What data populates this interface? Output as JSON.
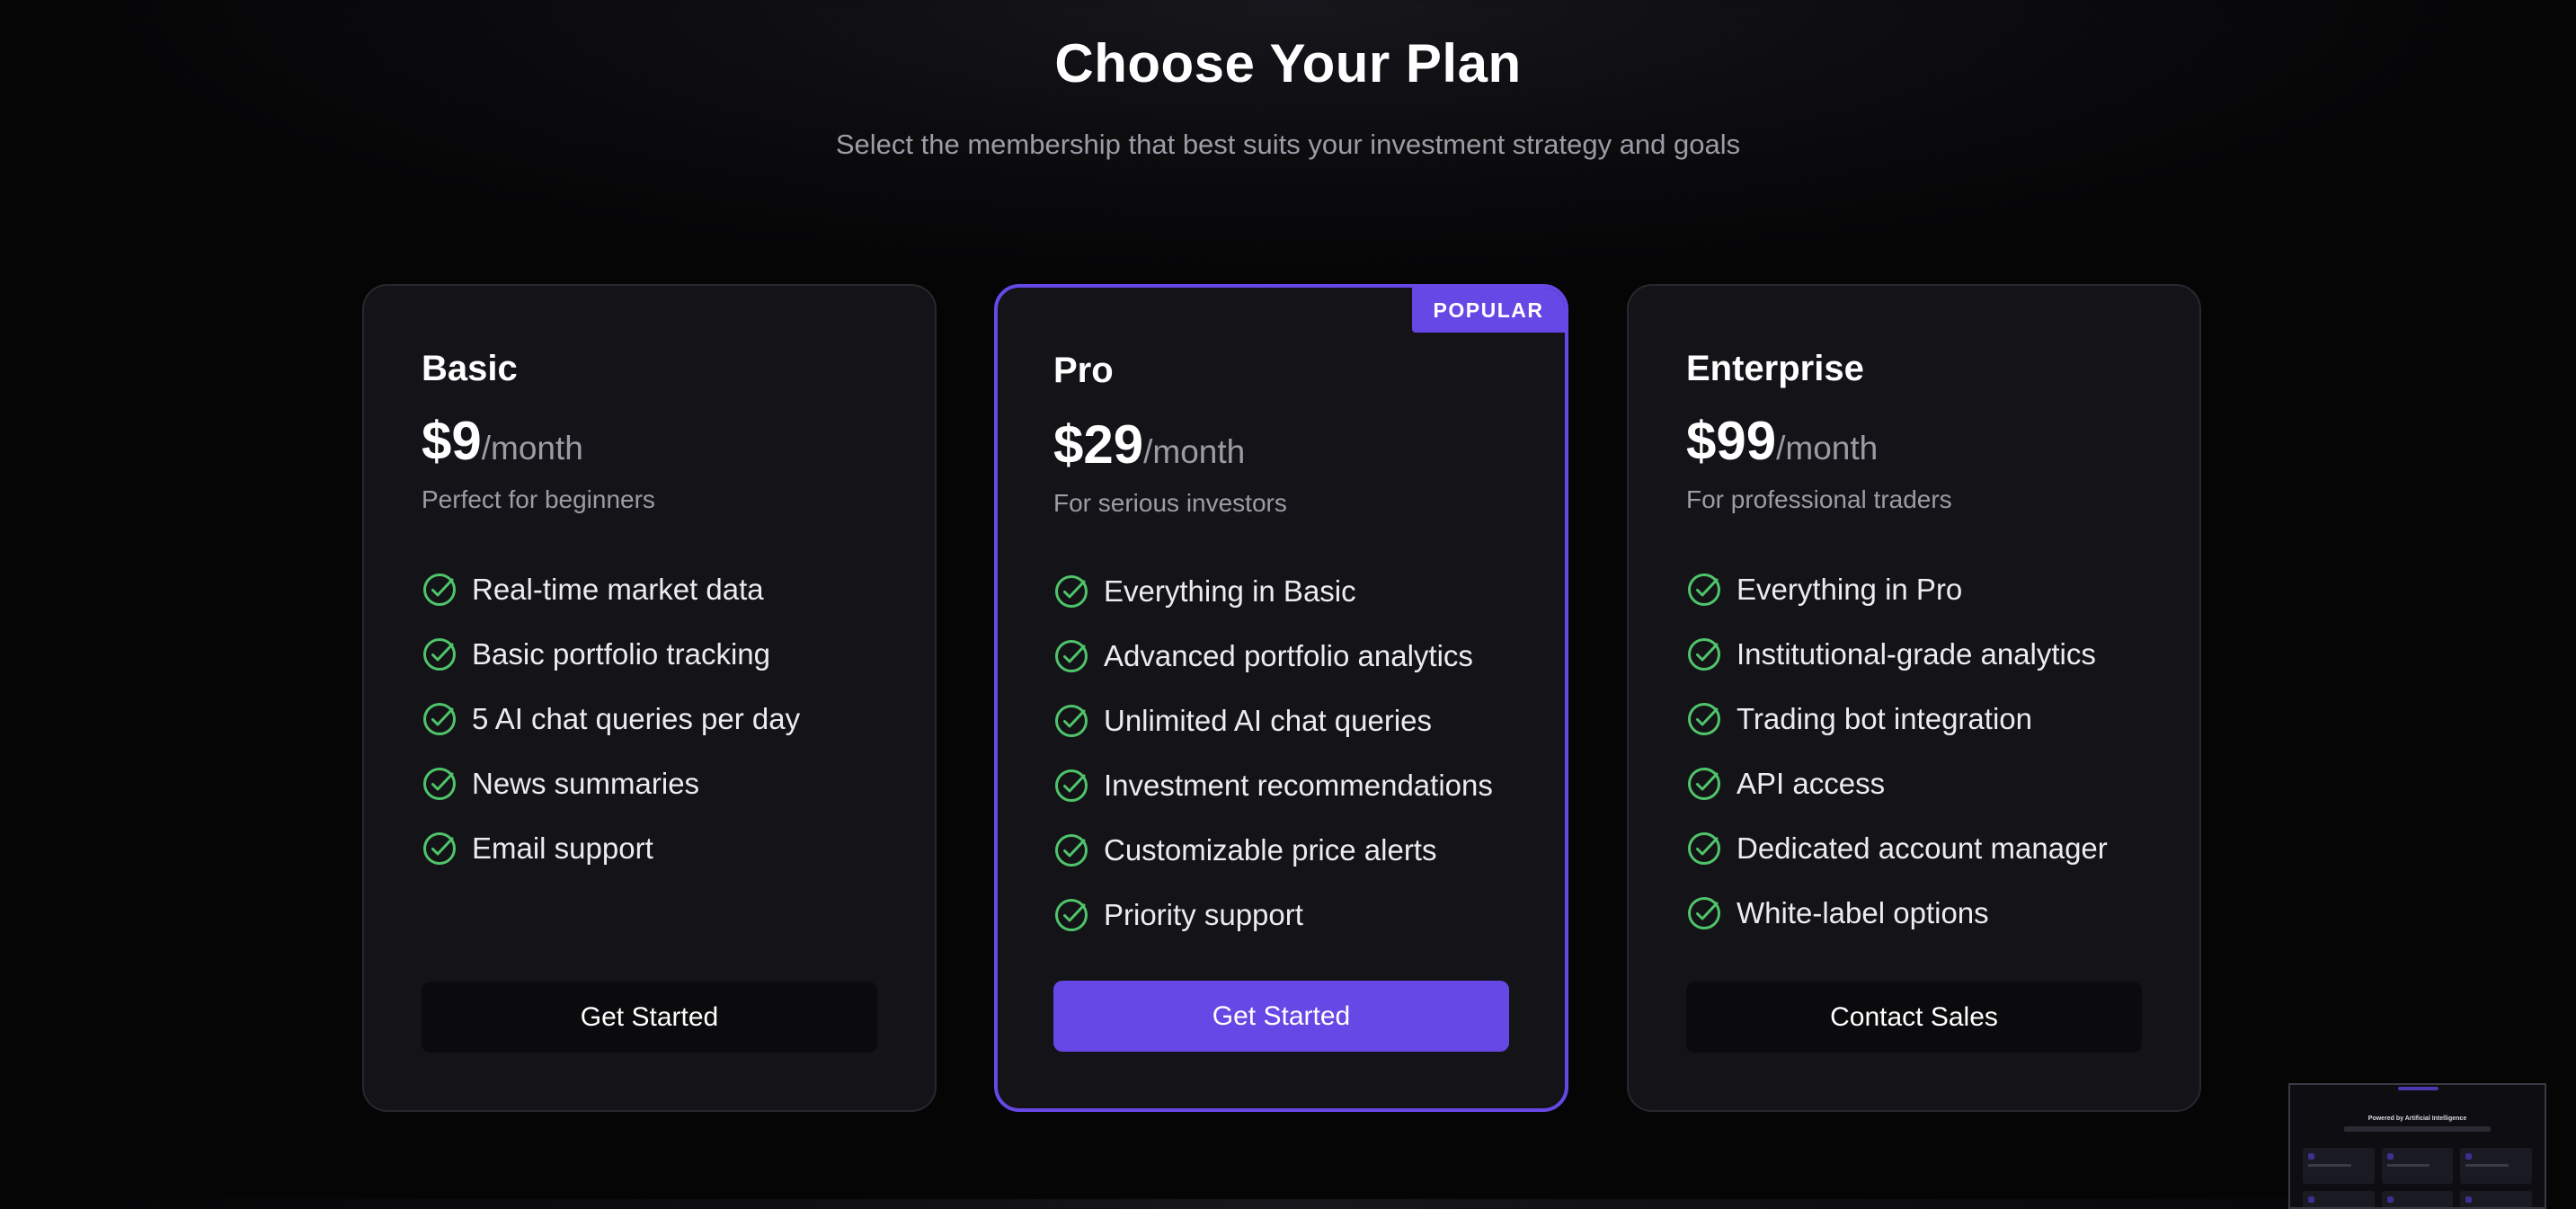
{
  "header": {
    "title": "Choose Your Plan",
    "subtitle": "Select the membership that best suits your investment strategy and goals"
  },
  "colors": {
    "accent": "#6548e6",
    "check": "#4fc46a",
    "card_bg": "#141418",
    "page_bg": "#050506"
  },
  "plans": [
    {
      "name": "Basic",
      "price": "$9",
      "period": "/month",
      "tagline": "Perfect for beginners",
      "features": [
        "Real-time market data",
        "Basic portfolio tracking",
        "5 AI chat queries per day",
        "News summaries",
        "Email support"
      ],
      "cta": "Get Started"
    },
    {
      "name": "Pro",
      "badge": "POPULAR",
      "price": "$29",
      "period": "/month",
      "tagline": "For serious investors",
      "features": [
        "Everything in Basic",
        "Advanced portfolio analytics",
        "Unlimited AI chat queries",
        "Investment recommendations",
        "Customizable price alerts",
        "Priority support"
      ],
      "cta": "Get Started"
    },
    {
      "name": "Enterprise",
      "price": "$99",
      "period": "/month",
      "tagline": "For professional traders",
      "features": [
        "Everything in Pro",
        "Institutional-grade analytics",
        "Trading bot integration",
        "API access",
        "Dedicated account manager",
        "White-label options"
      ],
      "cta": "Contact Sales"
    }
  ],
  "preview": {
    "title": "Powered by Artificial Intelligence"
  }
}
